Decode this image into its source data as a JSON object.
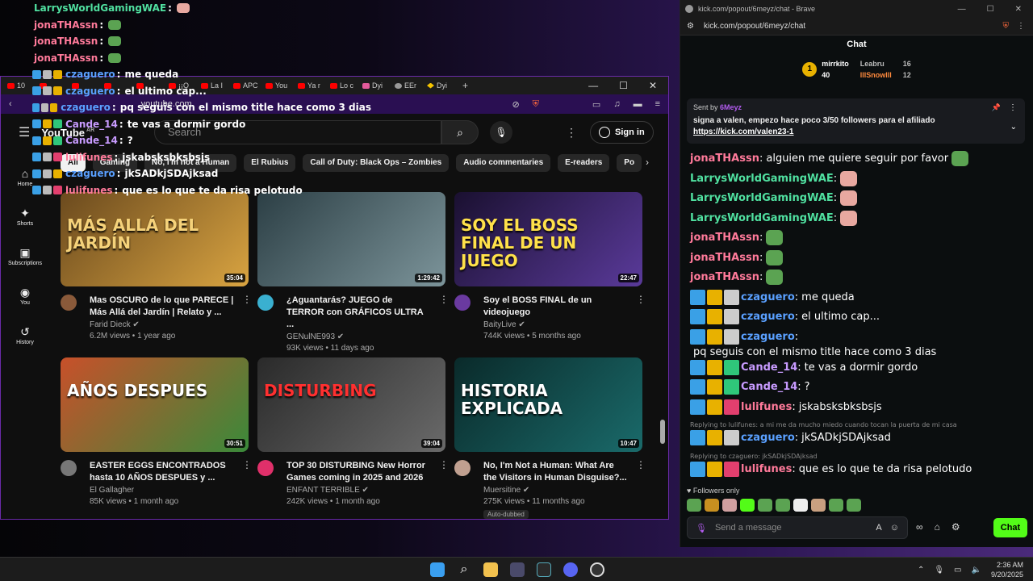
{
  "overlay_chat": [
    {
      "badges": [],
      "name": "LarrysWorldGamingWAE",
      "color": "#50e0a0",
      "message": "",
      "emote": "face"
    },
    {
      "badges": [],
      "name": "jonaTHAssn",
      "color": "#ff7a9a",
      "message": "",
      "emote": "frog"
    },
    {
      "badges": [],
      "name": "jonaTHAssn",
      "color": "#ff7a9a",
      "message": "",
      "emote": "frog"
    },
    {
      "badges": [],
      "name": "jonaTHAssn",
      "color": "#ff7a9a",
      "message": "",
      "emote": "frog"
    },
    {
      "badges": [
        "blue",
        "gray",
        "gold"
      ],
      "name": "czaguero",
      "color": "#5aa0ff",
      "message": "me queda",
      "emote": ""
    },
    {
      "badges": [
        "blue",
        "gray",
        "gold"
      ],
      "name": "czaguero",
      "color": "#5aa0ff",
      "message": "el ultimo cap...",
      "emote": ""
    },
    {
      "badges": [
        "blue",
        "gray",
        "gold"
      ],
      "name": "czaguero",
      "color": "#5aa0ff",
      "message": "pq seguis con el mismo title hace como 3 dias",
      "emote": ""
    },
    {
      "badges": [
        "blue",
        "gold",
        "green"
      ],
      "name": "Cande_14",
      "color": "#c89bff",
      "message": "te vas a dormir gordo",
      "emote": ""
    },
    {
      "badges": [
        "blue",
        "gold",
        "green"
      ],
      "name": "Cande_14",
      "color": "#c89bff",
      "message": "?",
      "emote": ""
    },
    {
      "badges": [
        "blue",
        "gray",
        "pink"
      ],
      "name": "lulifunes",
      "color": "#ff7a9a",
      "message": "jskabsksbksbsjs",
      "emote": ""
    },
    {
      "badges": [
        "blue",
        "gray",
        "gold"
      ],
      "name": "czaguero",
      "color": "#5aa0ff",
      "message": "jkSADkjSDAjksad",
      "emote": ""
    },
    {
      "badges": [
        "blue",
        "gray",
        "pink"
      ],
      "name": "lulifunes",
      "color": "#ff7a9a",
      "message": "que es lo que te da risa pelotudo",
      "emote": ""
    }
  ],
  "browser": {
    "tabs": [
      {
        "label": "10",
        "icon": "youtube"
      },
      {
        "label": "",
        "icon": "youtube"
      },
      {
        "label": "",
        "icon": "youtube"
      },
      {
        "label": "",
        "icon": "youtube"
      },
      {
        "label": "",
        "icon": "youtube"
      },
      {
        "label": "¡¡Q",
        "icon": "youtube"
      },
      {
        "label": "La I",
        "icon": "youtube"
      },
      {
        "label": "APC",
        "icon": "youtube"
      },
      {
        "label": "You",
        "icon": "youtube"
      },
      {
        "label": "Ya r",
        "icon": "youtube"
      },
      {
        "label": "Lo c",
        "icon": "youtube"
      },
      {
        "label": "Dyi",
        "icon": "pink"
      },
      {
        "label": "EEr",
        "icon": "globe"
      },
      {
        "label": "Dyi",
        "icon": "bolt"
      }
    ],
    "new_tab": "+",
    "url": "youtube.com",
    "youtube": {
      "logo": "YouTube",
      "logo_region": "AR",
      "search_placeholder": "Search",
      "sign_in": "Sign in",
      "nav": [
        {
          "label": "Home",
          "icon": "⌂"
        },
        {
          "label": "Shorts",
          "icon": "✦"
        },
        {
          "label": "Subscriptions",
          "icon": "▣"
        },
        {
          "label": "You",
          "icon": "◉"
        },
        {
          "label": "History",
          "icon": "↺"
        }
      ],
      "chips": [
        "All",
        "Gaming",
        "No, I'm not a Human",
        "El Rubius",
        "Call of Duty: Black Ops – Zombies",
        "Audio commentaries",
        "E-readers",
        "Po"
      ],
      "videos": [
        {
          "title": "Mas OSCURO de lo que PARECE | Más Allá del Jardín | Relato y ...",
          "channel": "Farid Dieck",
          "verified": true,
          "views": "6.2M views",
          "age": "1 year ago",
          "duration": "35:04",
          "thumb_text": "MÁS ALLÁ DEL JARDÍN",
          "thumb_colors": [
            "#6b4a1e",
            "#d9a441"
          ],
          "avatar_color": "#8a5a3a",
          "autodub": ""
        },
        {
          "title": "¿Aguantarás? JUEGO de TERROR con GRÁFICOS ULTRA ...",
          "channel": "GENulNE993",
          "verified": true,
          "views": "93K views",
          "age": "11 days ago",
          "duration": "1:29:42",
          "thumb_text": "",
          "thumb_colors": [
            "#2c3f45",
            "#7c949a"
          ],
          "avatar_color": "#3ab0d0",
          "autodub": ""
        },
        {
          "title": "Soy el BOSS FINAL de un videojuego",
          "channel": "BaityLive",
          "verified": true,
          "views": "744K views",
          "age": "5 months ago",
          "duration": "22:47",
          "thumb_text": "SOY EL BOSS FINAL DE UN JUEGO",
          "thumb_colors": [
            "#1a1030",
            "#5a3a9a"
          ],
          "avatar_color": "#6a3aa0",
          "autodub": ""
        },
        {
          "title": "EASTER EGGS ENCONTRADOS hasta 10 AÑOS DESPUES y ...",
          "channel": "El Gallagher",
          "verified": false,
          "views": "85K views",
          "age": "1 month ago",
          "duration": "30:51",
          "thumb_text": "AÑOS DESPUES",
          "thumb_colors": [
            "#c8502a",
            "#3a8a3a"
          ],
          "avatar_color": "#777777",
          "autodub": ""
        },
        {
          "title": "TOP 30 DISTURBING New Horror Games coming in 2025 and 2026",
          "channel": "ENFANT TERRIBLE",
          "verified": true,
          "views": "242K views",
          "age": "1 month ago",
          "duration": "39:04",
          "thumb_text": "DISTURBING",
          "thumb_colors": [
            "#2a2a2a",
            "#6a6a6a"
          ],
          "avatar_color": "#e0306a",
          "autodub": ""
        },
        {
          "title": "No, I'm Not a Human: What Are the Visitors in Human Disguise?...",
          "channel": "Muersitine",
          "verified": true,
          "views": "275K views",
          "age": "11 months ago",
          "duration": "10:47",
          "thumb_text": "HISTORIA EXPLICADA",
          "thumb_colors": [
            "#0a2a2a",
            "#1a6a6a"
          ],
          "avatar_color": "#c0a090",
          "autodub": "Auto-dubbed"
        }
      ]
    }
  },
  "kick": {
    "window_title": "kick.com/popout/6meyz/chat - Brave",
    "url": "kick.com/popout/6meyz/chat",
    "header": "Chat",
    "leaderboard": {
      "top": {
        "rank": "1",
        "name": "mirrkito",
        "count": "40"
      },
      "second": {
        "name": "Leabru",
        "count": "16"
      },
      "third": {
        "name": "lllSnowlll",
        "count": "12"
      }
    },
    "pinned": {
      "sent_by_label": "Sent by",
      "sender": "6Meyz",
      "message": "signa a valen, empezo hace poco 3/50 followers para el afiliado",
      "link": "https://kick.com/valen23-1"
    },
    "messages": [
      {
        "badges": [],
        "name": "jonaTHAssn",
        "color": "#ff7a9a",
        "message": "alguien me quiere seguir por favor",
        "emote": "frog",
        "reply": ""
      },
      {
        "badges": [],
        "name": "LarrysWorldGamingWAE",
        "color": "#50e0a0",
        "message": "",
        "emote": "face",
        "reply": ""
      },
      {
        "badges": [],
        "name": "LarrysWorldGamingWAE",
        "color": "#50e0a0",
        "message": "",
        "emote": "face",
        "reply": ""
      },
      {
        "badges": [],
        "name": "LarrysWorldGamingWAE",
        "color": "#50e0a0",
        "message": "",
        "emote": "face",
        "reply": ""
      },
      {
        "badges": [],
        "name": "jonaTHAssn",
        "color": "#ff7a9a",
        "message": "",
        "emote": "frog",
        "reply": ""
      },
      {
        "badges": [],
        "name": "jonaTHAssn",
        "color": "#ff7a9a",
        "message": "",
        "emote": "frog",
        "reply": ""
      },
      {
        "badges": [],
        "name": "jonaTHAssn",
        "color": "#ff7a9a",
        "message": "",
        "emote": "frog",
        "reply": ""
      },
      {
        "badges": [
          "blue",
          "gold",
          "gray"
        ],
        "name": "czaguero",
        "color": "#5aa0ff",
        "message": "me queda",
        "emote": "",
        "reply": ""
      },
      {
        "badges": [
          "blue",
          "gold",
          "gray"
        ],
        "name": "czaguero",
        "color": "#5aa0ff",
        "message": "el ultimo cap...",
        "emote": "",
        "reply": ""
      },
      {
        "badges": [
          "blue",
          "gold",
          "gray"
        ],
        "name": "czaguero",
        "color": "#5aa0ff",
        "message": "pq seguis con el mismo title hace como 3 dias",
        "emote": "",
        "reply": ""
      },
      {
        "badges": [
          "blue",
          "gold",
          "green"
        ],
        "name": "Cande_14",
        "color": "#c89bff",
        "message": "te vas a dormir gordo",
        "emote": "",
        "reply": ""
      },
      {
        "badges": [
          "blue",
          "gold",
          "green"
        ],
        "name": "Cande_14",
        "color": "#c89bff",
        "message": "?",
        "emote": "",
        "reply": ""
      },
      {
        "badges": [
          "blue",
          "gold",
          "pink"
        ],
        "name": "lulifunes",
        "color": "#ff7a9a",
        "message": "jskabsksbksbsjs",
        "emote": "",
        "reply": ""
      },
      {
        "badges": [
          "blue",
          "gold",
          "gray"
        ],
        "name": "czaguero",
        "color": "#5aa0ff",
        "message": "jkSADkjSDAjksad",
        "emote": "",
        "reply": "Replying to lulifunes: a mi me da mucho miedo cuando tocan la puerta de mi casa"
      },
      {
        "badges": [
          "blue",
          "gold",
          "pink"
        ],
        "name": "lulifunes",
        "color": "#ff7a9a",
        "message": "que es lo que te da risa pelotudo",
        "emote": "",
        "reply": "Replying to czaguero: jkSADkjSDAjksad"
      }
    ],
    "followers_only": "Followers only",
    "input_placeholder": "Send a message",
    "chat_button": "Chat",
    "accent": "#53fc18"
  },
  "taskbar": {
    "time": "2:36 AM",
    "date": "9/20/2025"
  }
}
